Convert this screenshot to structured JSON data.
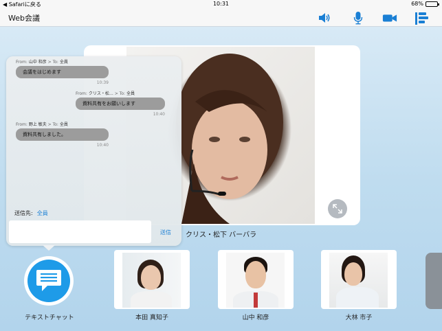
{
  "status_bar": {
    "back_label": "◀ Safariに戻る",
    "time": "10:31",
    "battery_percent": "68%",
    "battery_level": 0.68
  },
  "nav": {
    "title": "Web会議",
    "icons": [
      "speaker-icon",
      "microphone-icon",
      "video-camera-icon",
      "share-screen-icon"
    ],
    "accent_color": "#1a7fd4"
  },
  "main_video": {
    "speaker_name": "クリス・松下 バーバラ"
  },
  "chat": {
    "messages": [
      {
        "from_label": "From:",
        "from": "山中 和彦",
        "to_label": "> To:",
        "to": "全員",
        "text": "会議をはじめます",
        "time": "10:39"
      },
      {
        "from_label": "From:",
        "from": "クリス・松…",
        "to_label": "> To:",
        "to": "全員",
        "text": "資料共有をお願いします",
        "time": "10:40"
      },
      {
        "from_label": "From:",
        "from": "野上 敏夫",
        "to_label": "> To:",
        "to": "全員",
        "text": "資料共有しました。",
        "time": "10:40"
      }
    ],
    "send_to_label": "送信先:",
    "send_to_value": "全員",
    "input_value": "",
    "send_button": "送信"
  },
  "bottom": {
    "text_chat_label": "テキストチャット",
    "participants": [
      {
        "name": "本田 真知子"
      },
      {
        "name": "山中 和彦"
      },
      {
        "name": "大林 市子"
      }
    ]
  }
}
